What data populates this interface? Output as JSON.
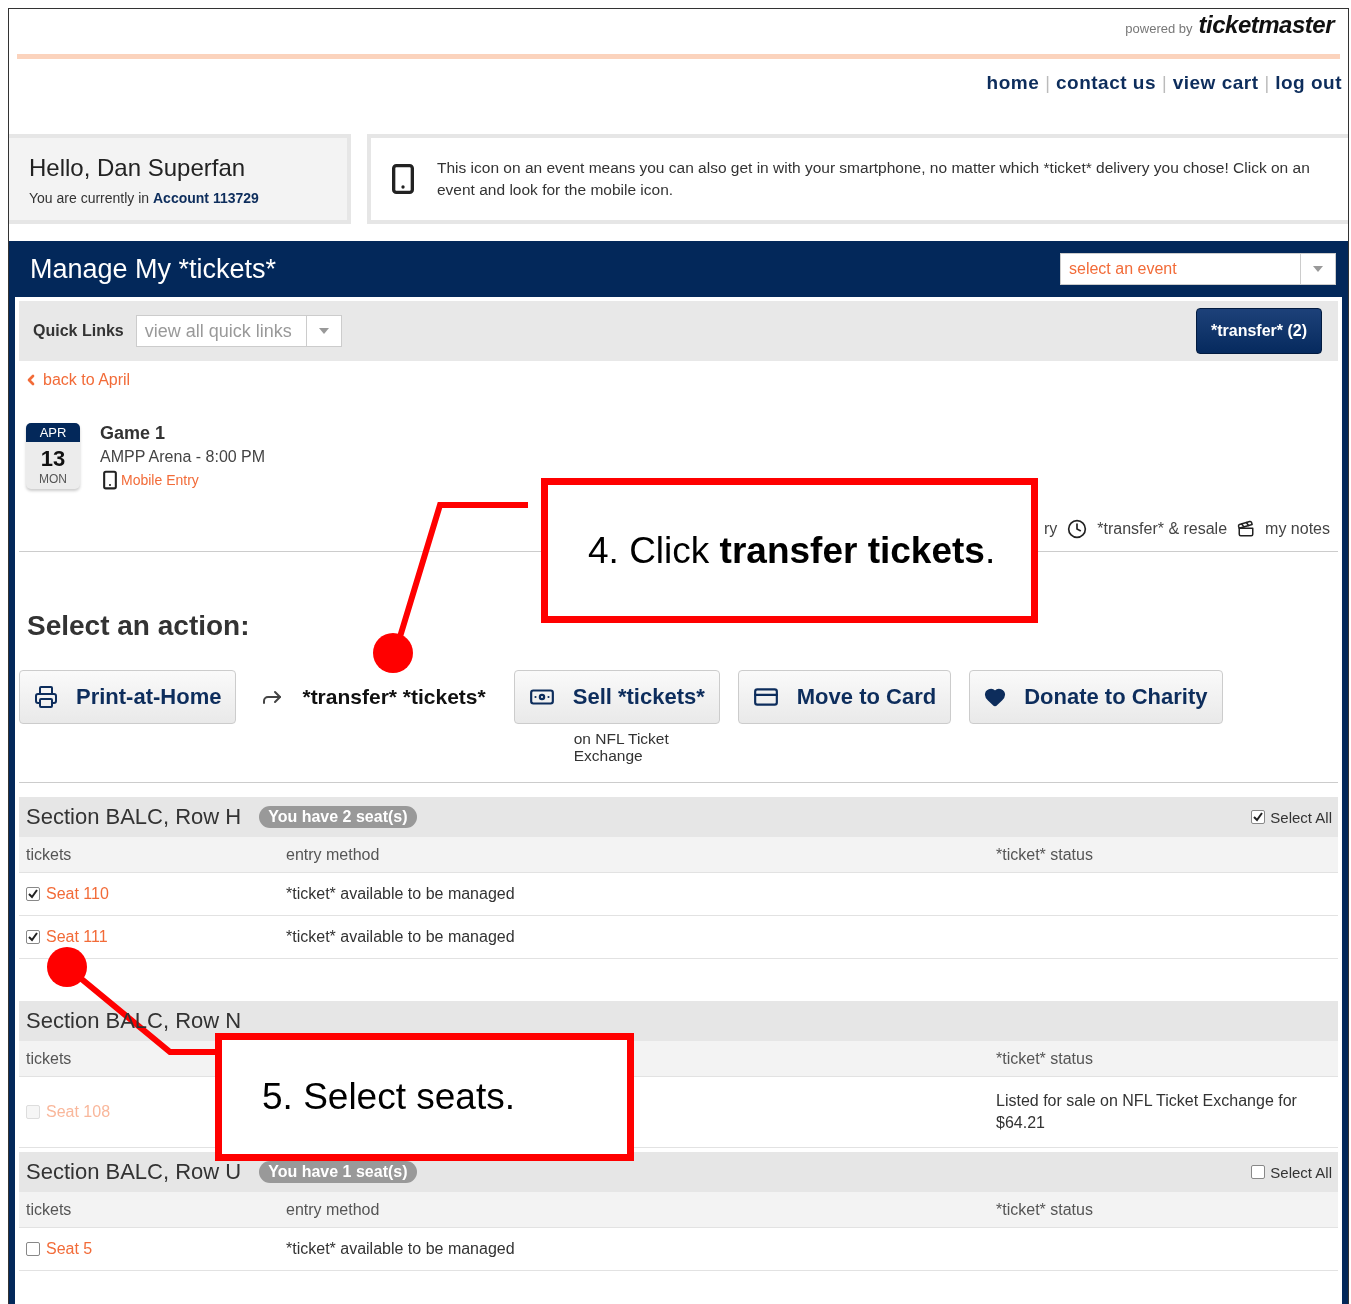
{
  "header": {
    "powered_by": "powered by",
    "brand": "ticketmaster",
    "nav": [
      "home",
      "contact us",
      "view cart",
      "log out"
    ],
    "nav_separator": "|"
  },
  "greeting": {
    "title": "Hello, Dan Superfan",
    "account_line": "You are currently in **Account 113729**"
  },
  "notice": {
    "text": "This icon on an event means you can also get in with your smartphone, no matter which *ticket* delivery you chose! Click on an event and look for the mobile icon."
  },
  "title_bar": {
    "title": "Manage My *tickets*",
    "event_select": {
      "placeholder": "select an event"
    }
  },
  "quick_links": {
    "label": "Quick Links",
    "select": {
      "placeholder": "view all quick links"
    },
    "transfer_button": "*transfer* (2)"
  },
  "back_link": "back to April",
  "event": {
    "month": "APR",
    "day": "13",
    "weekday": "MON",
    "name": "Game 1",
    "venue": "AMPP Arena - 8:00 PM",
    "mobile_entry": "Mobile Entry"
  },
  "event_links": [
    {
      "kind": "text",
      "label": "ry"
    },
    {
      "kind": "clock",
      "label": "*transfer* & resale"
    },
    {
      "kind": "notes",
      "label": "my notes"
    }
  ],
  "actions": {
    "heading": "Select an action:",
    "items": [
      {
        "kind": "print",
        "label": "Print-at-Home"
      },
      {
        "kind": "transfer",
        "label": "*transfer* *tickets*"
      },
      {
        "kind": "sell",
        "label": "Sell *tickets*",
        "note": "on NFL Ticket Exchange"
      },
      {
        "kind": "card",
        "label": "Move to Card"
      },
      {
        "kind": "charity",
        "label": "Donate to Charity"
      }
    ]
  },
  "sections": [
    {
      "title": "Section BALC, Row H",
      "badge": "You have 2 seat(s)",
      "select_all": {
        "label": "Select All",
        "checked": true
      },
      "columns": {
        "tickets": "tickets",
        "entry": "entry method",
        "status": "*ticket* status"
      },
      "rows": [
        {
          "seat": "Seat 110",
          "checked": true,
          "disabled": false,
          "entry": "*ticket* available to be managed"
        },
        {
          "seat": "Seat 111",
          "checked": true,
          "disabled": false,
          "entry": "*ticket* available to be managed"
        }
      ]
    },
    {
      "title": "Section BALC, Row N",
      "columns": {
        "tickets": "tickets",
        "status": "*ticket* status"
      },
      "rows": [
        {
          "seat": "Seat 108",
          "checked": false,
          "disabled": true,
          "status": "Listed for sale on NFL Ticket Exchange for $64.21"
        }
      ]
    },
    {
      "title": "Section BALC, Row U",
      "badge": "You have 1 seat(s)",
      "select_all": {
        "label": "Select All",
        "checked": false
      },
      "columns": {
        "tickets": "tickets",
        "entry": "entry method",
        "status": "*ticket* status"
      },
      "rows": [
        {
          "seat": "Seat 5",
          "checked": false,
          "disabled": false,
          "entry": "*ticket* available to be managed"
        }
      ]
    }
  ],
  "callouts": [
    {
      "text": "4. Click **transfer tickets**."
    },
    {
      "text": "5. Select seats."
    }
  ]
}
